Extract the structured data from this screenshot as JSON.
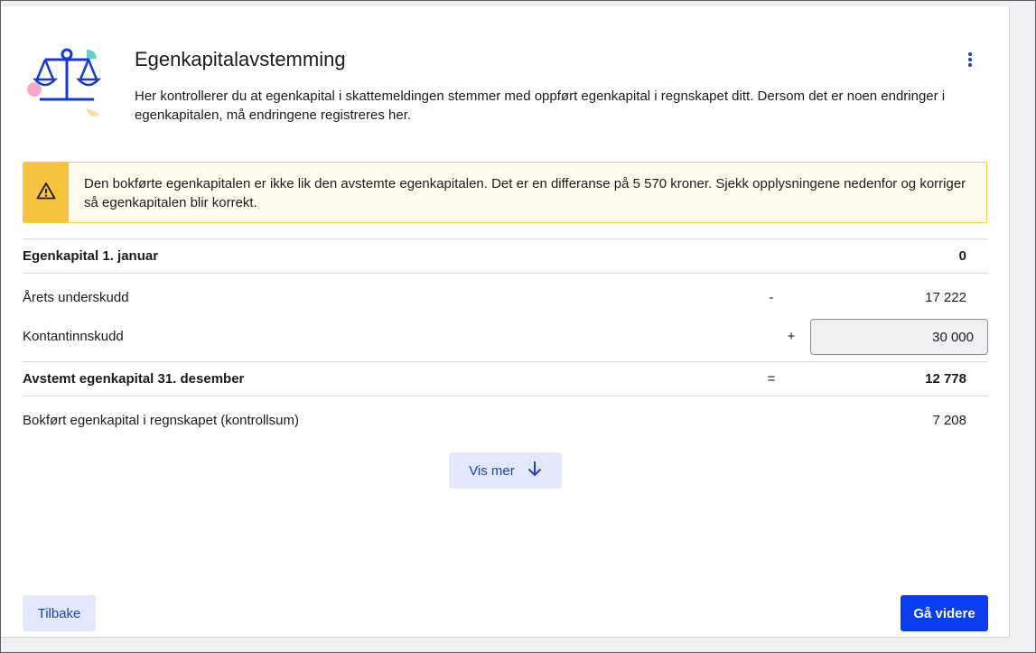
{
  "header": {
    "title": "Egenkapitalavstemming",
    "description": "Her kontrollerer du at egenkapital i skattemeldingen stemmer med oppført egenkapital i regnskapet ditt. Dersom det er noen endringer i egenkapitalen, må endringene registreres her.",
    "icon": "scales-icon",
    "menu_icon": "kebab-menu-icon"
  },
  "alert": {
    "icon": "warning-triangle-icon",
    "text": "Den bokførte egenkapitalen er ikke lik den avstemte egenkapitalen. Det er en differanse på 5 570 kroner. Sjekk opplysningene nedenfor og korriger så egenkapitalen blir korrekt."
  },
  "reconciliation": {
    "opening": {
      "label": "Egenkapital 1. januar",
      "value": "0"
    },
    "deficit": {
      "label": "Årets underskudd",
      "operator": "-",
      "value": "17 222"
    },
    "cash_contribution": {
      "label": "Kontantinnskudd",
      "operator": "+",
      "value": "30 000"
    },
    "reconciled": {
      "label": "Avstemt egenkapital 31. desember",
      "operator": "=",
      "value": "12 778"
    },
    "booked": {
      "label": "Bokført egenkapital i regnskapet (kontrollsum)",
      "value": "7 208"
    }
  },
  "actions": {
    "show_more": "Vis mer",
    "back": "Tilbake",
    "next": "Gå videre"
  },
  "colors": {
    "primary": "#0a3cf0",
    "secondary_bg": "#e3e8fc",
    "warning": "#f7c23e",
    "warning_bg": "#fffbec"
  }
}
